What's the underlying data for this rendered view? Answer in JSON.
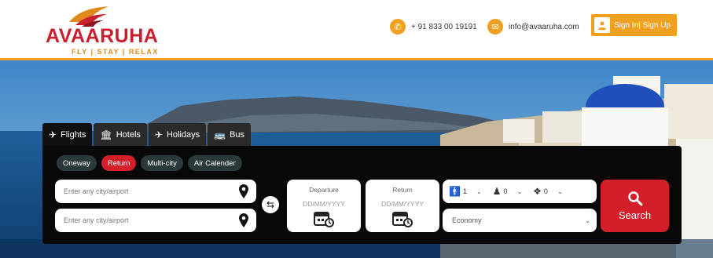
{
  "brand": {
    "name": "AVAARUHA",
    "tagline": "FLY | STAY | RELAX"
  },
  "header": {
    "phone": "+ 91 833 00 19191",
    "email": "info@avaaruha.com",
    "auth_label": "Sign In| Sign Up"
  },
  "tabs": [
    {
      "label": "Flights",
      "icon": "plane-icon"
    },
    {
      "label": "Hotels",
      "icon": "hotel-icon"
    },
    {
      "label": "Holidays",
      "icon": "holidays-icon"
    },
    {
      "label": "Bus",
      "icon": "bus-icon"
    }
  ],
  "trip_types": [
    "Oneway",
    "Return",
    "Multi-city",
    "Air Calender"
  ],
  "active_trip_type": "Return",
  "form": {
    "from_placeholder": "Enter any city/airport",
    "to_placeholder": "Enter any city/airport",
    "departure_label": "Departure",
    "departure_placeholder": "DD/MM/YYYY",
    "return_label": "Return",
    "return_placeholder": "DD/MM/YYYY",
    "adults": "1",
    "children": "0",
    "infants": "0",
    "cabin_class": "Economy",
    "search_label": "Search"
  },
  "colors": {
    "brand_red": "#c8202f",
    "accent_orange": "#f0a020",
    "search_red": "#d41f2b"
  }
}
